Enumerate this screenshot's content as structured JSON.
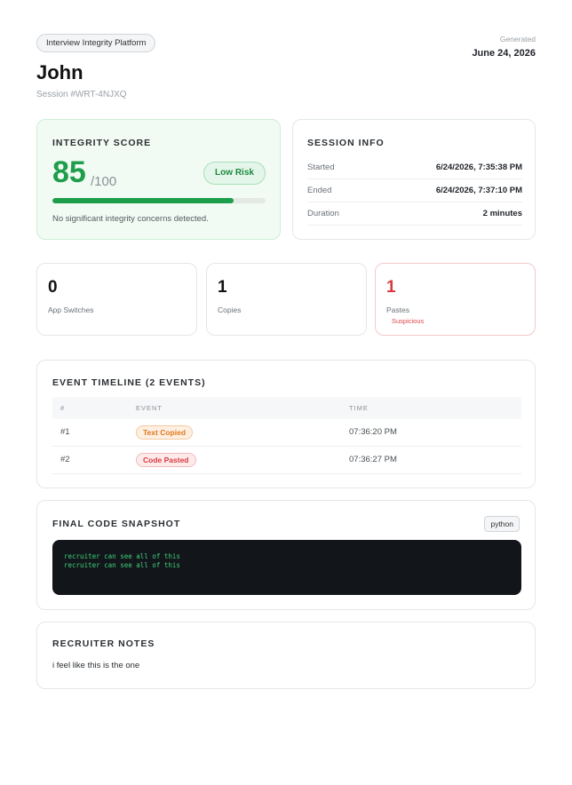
{
  "header": {
    "platform_label": "Interview Integrity Platform",
    "generated_label": "Generated",
    "generated_date": "June 24, 2026",
    "candidate_name": "John",
    "session_id": "Session #WRT-4NJXQ"
  },
  "integrity": {
    "title": "INTEGRITY SCORE",
    "score": "85",
    "score_max": "/100",
    "score_fraction": 0.85,
    "risk_label": "Low Risk",
    "note": "No significant integrity concerns detected.",
    "color": "#1e9e4a"
  },
  "session_info": {
    "title": "SESSION INFO",
    "rows": [
      {
        "label": "Started",
        "value": "6/24/2026, 7:35:38 PM"
      },
      {
        "label": "Ended",
        "value": "6/24/2026, 7:37:10 PM"
      },
      {
        "label": "Duration",
        "value": "2 minutes"
      }
    ]
  },
  "stats": [
    {
      "value": "0",
      "label": "App Switches"
    },
    {
      "value": "1",
      "label": "Copies"
    },
    {
      "value": "1",
      "label": "Pastes",
      "sub": "Suspicious"
    }
  ],
  "timeline": {
    "title": "EVENT TIMELINE (2 EVENTS)",
    "columns": [
      "#",
      "EVENT",
      "TIME"
    ],
    "rows": [
      {
        "num": "#1",
        "event": "Text Copied",
        "time": "07:36:20 PM"
      },
      {
        "num": "#2",
        "event": "Code Pasted",
        "time": "07:36:27 PM"
      }
    ]
  },
  "code_snapshot": {
    "title": "FINAL CODE SNAPSHOT",
    "language": "python",
    "lines": [
      "recruiter can see all of this",
      "recruiter can see all of this"
    ]
  },
  "notes": {
    "title": "RECRUITER NOTES",
    "text": "i feel like this is the one"
  }
}
